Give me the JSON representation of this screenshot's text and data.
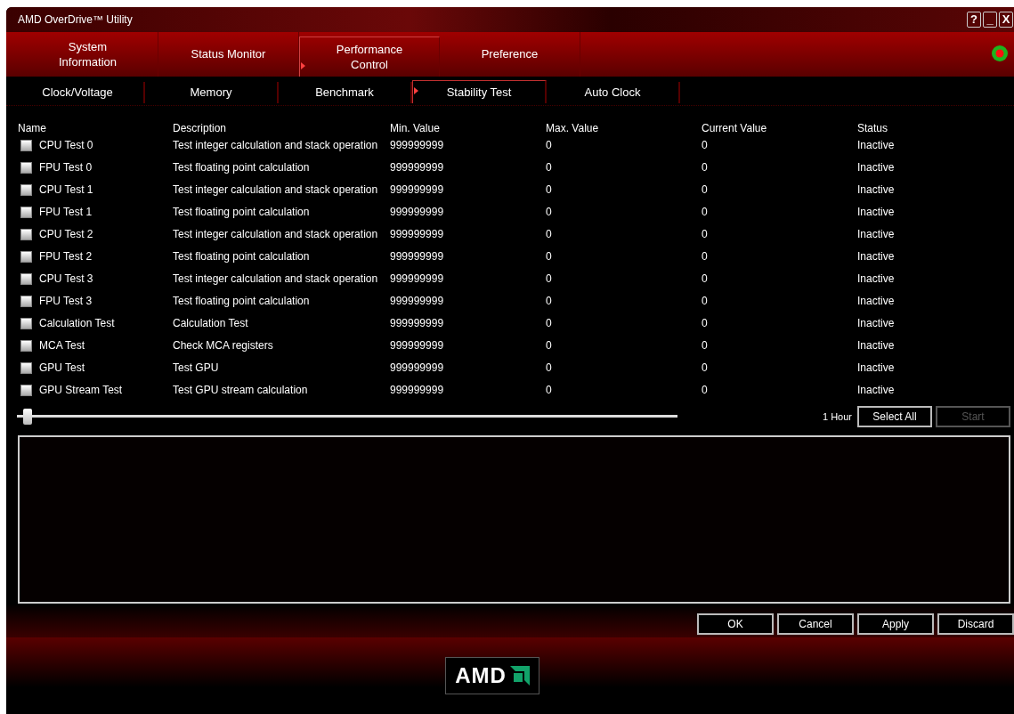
{
  "window": {
    "title": "AMD OverDrive™ Utility",
    "controls": [
      "?",
      "_",
      "X"
    ]
  },
  "main_tabs": [
    {
      "label": "System Information",
      "selected": false
    },
    {
      "label": "Status Monitor",
      "selected": false
    },
    {
      "label": "Performance Control",
      "selected": true
    },
    {
      "label": "Preference",
      "selected": false
    }
  ],
  "sub_tabs": [
    {
      "label": "Clock/Voltage",
      "selected": false
    },
    {
      "label": "Memory",
      "selected": false
    },
    {
      "label": "Benchmark",
      "selected": false
    },
    {
      "label": "Stability Test",
      "selected": true
    },
    {
      "label": "Auto Clock",
      "selected": false
    }
  ],
  "table": {
    "columns": [
      "Name",
      "Description",
      "Min. Value",
      "Max. Value",
      "Current Value",
      "Status"
    ],
    "rows": [
      {
        "name": "CPU Test 0",
        "checked": false,
        "description": "Test integer calculation and stack operation",
        "min_value": "999999999",
        "max_value": "0",
        "current_value": "0",
        "status": "Inactive"
      },
      {
        "name": "FPU Test 0",
        "checked": false,
        "description": "Test floating point calculation",
        "min_value": "999999999",
        "max_value": "0",
        "current_value": "0",
        "status": "Inactive"
      },
      {
        "name": "CPU Test 1",
        "checked": false,
        "description": "Test integer calculation and stack operation",
        "min_value": "999999999",
        "max_value": "0",
        "current_value": "0",
        "status": "Inactive"
      },
      {
        "name": "FPU Test 1",
        "checked": false,
        "description": "Test floating point calculation",
        "min_value": "999999999",
        "max_value": "0",
        "current_value": "0",
        "status": "Inactive"
      },
      {
        "name": "CPU Test 2",
        "checked": false,
        "description": "Test integer calculation and stack operation",
        "min_value": "999999999",
        "max_value": "0",
        "current_value": "0",
        "status": "Inactive"
      },
      {
        "name": "FPU Test 2",
        "checked": false,
        "description": "Test floating point calculation",
        "min_value": "999999999",
        "max_value": "0",
        "current_value": "0",
        "status": "Inactive"
      },
      {
        "name": "CPU Test 3",
        "checked": false,
        "description": "Test integer calculation and stack operation",
        "min_value": "999999999",
        "max_value": "0",
        "current_value": "0",
        "status": "Inactive"
      },
      {
        "name": "FPU Test 3",
        "checked": false,
        "description": "Test floating point calculation",
        "min_value": "999999999",
        "max_value": "0",
        "current_value": "0",
        "status": "Inactive"
      },
      {
        "name": "Calculation Test",
        "checked": false,
        "description": "Calculation Test",
        "min_value": "999999999",
        "max_value": "0",
        "current_value": "0",
        "status": "Inactive"
      },
      {
        "name": "MCA Test",
        "checked": false,
        "description": "Check MCA registers",
        "min_value": "999999999",
        "max_value": "0",
        "current_value": "0",
        "status": "Inactive"
      },
      {
        "name": "GPU Test",
        "checked": false,
        "description": "Test GPU",
        "min_value": "999999999",
        "max_value": "0",
        "current_value": "0",
        "status": "Inactive"
      },
      {
        "name": "GPU Stream Test",
        "checked": false,
        "description": "Test GPU stream calculation",
        "min_value": "999999999",
        "max_value": "0",
        "current_value": "0",
        "status": "Inactive"
      }
    ]
  },
  "duration": {
    "level": 0.01,
    "reading": "1 Hour"
  },
  "test_buttons": [
    {
      "label": "Select All",
      "disabled": false
    },
    {
      "label": "Start",
      "disabled": true
    }
  ],
  "dialog_buttons": [
    "OK",
    "Cancel",
    "Apply",
    "Discard"
  ],
  "logo": {
    "text": "AMD"
  }
}
